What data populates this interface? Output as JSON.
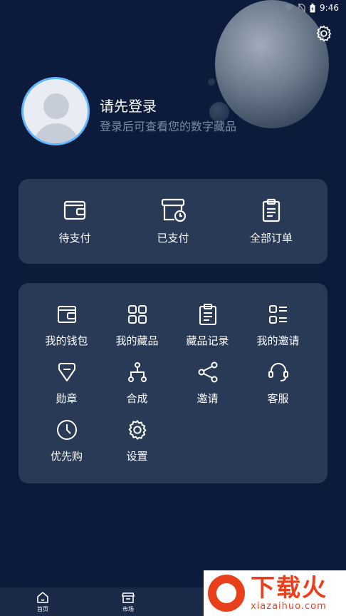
{
  "status_bar": {
    "time": "9:46",
    "icons": [
      "wifi-icon",
      "no-sim-icon",
      "battery-icon"
    ]
  },
  "header": {
    "settings_icon": "gear-icon",
    "login_title": "请先登录",
    "login_subtitle": "登录后可查看您的数字藏品"
  },
  "orders": [
    {
      "label": "待支付",
      "icon": "wallet-icon"
    },
    {
      "label": "已支付",
      "icon": "paid-box-clock-icon"
    },
    {
      "label": "全部订单",
      "icon": "clipboard-icon"
    }
  ],
  "menu": [
    {
      "label": "我的钱包",
      "icon": "wallet-icon"
    },
    {
      "label": "我的藏品",
      "icon": "grid-icon"
    },
    {
      "label": "藏品记录",
      "icon": "clipboard-list-icon"
    },
    {
      "label": "我的邀请",
      "icon": "list-icon"
    },
    {
      "label": "勋章",
      "icon": "badge-icon"
    },
    {
      "label": "合成",
      "icon": "merge-icon"
    },
    {
      "label": "邀请",
      "icon": "share-icon"
    },
    {
      "label": "客服",
      "icon": "headset-icon"
    },
    {
      "label": "优先购",
      "icon": "clock-icon"
    },
    {
      "label": "设置",
      "icon": "gear-icon"
    }
  ],
  "tabbar": [
    {
      "label": "首页",
      "icon": "home-icon"
    },
    {
      "label": "市场",
      "icon": "store-icon"
    }
  ],
  "watermark": {
    "big": "下载火",
    "small": "xiazaihuo.com"
  },
  "colors": {
    "background": "#0c1b3b",
    "card": "#283a56",
    "accent": "#5fb6ff",
    "muted_text": "#7f8ba3"
  }
}
